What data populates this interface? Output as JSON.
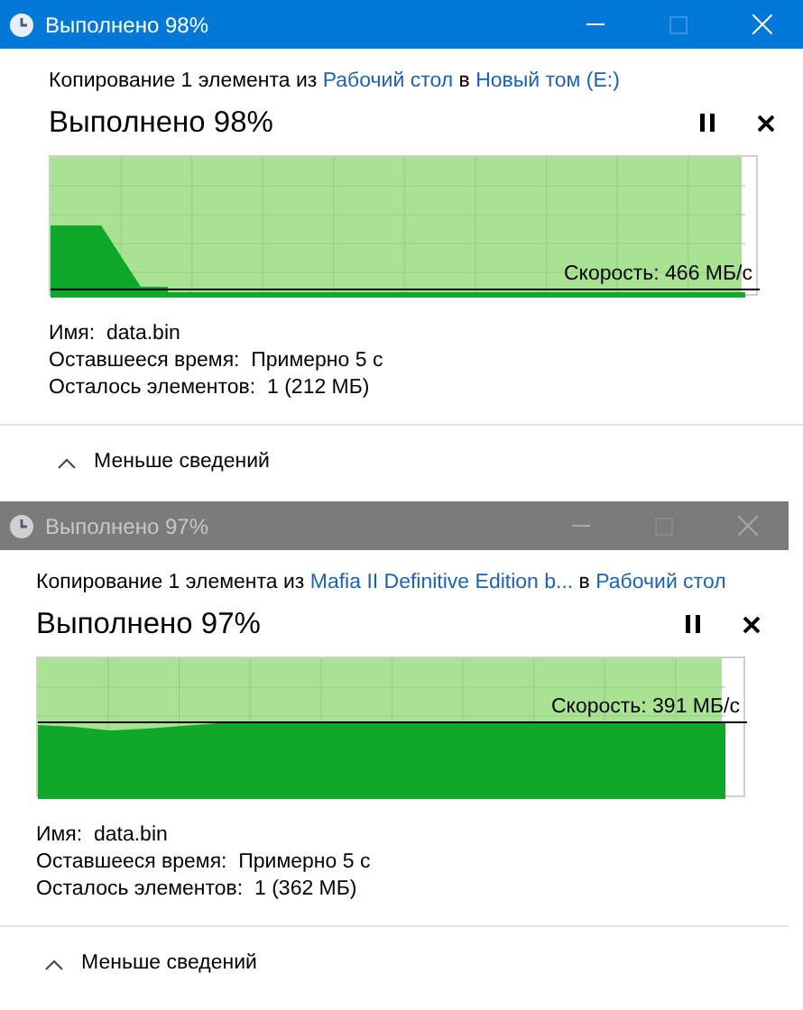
{
  "windows": [
    {
      "title": "Выполнено 98%",
      "active": true,
      "copy_line": {
        "prefix": "Копирование 1 элемента из",
        "source": "Рабочий стол",
        "middle": "в",
        "destination": "Новый том (E:)"
      },
      "heading": "Выполнено 98%",
      "progress": {
        "level": 0.98
      },
      "speed": "Скорость: 466 МБ/с",
      "details": [
        {
          "label": "Имя:",
          "value": "data.bin"
        },
        {
          "label": "Оставшееся время:",
          "value": "Примерно 5 с"
        },
        {
          "label": "Осталось элементов:",
          "value": "1 (212 МБ)"
        }
      ],
      "toggle": "Меньше сведений"
    },
    {
      "title": "Выполнено 97%",
      "active": false,
      "copy_line": {
        "prefix": "Копирование 1 элемента из",
        "source": "Mafia II Definitive Edition b...",
        "middle": "в",
        "destination": "Рабочий стол"
      },
      "heading": "Выполнено 97%",
      "progress": {
        "level": 0.97
      },
      "speed": "Скорость: 391 МБ/с",
      "details": [
        {
          "label": "Имя:",
          "value": "data.bin"
        },
        {
          "label": "Оставшееся время:",
          "value": "Примерно 5 с"
        },
        {
          "label": "Осталось элементов:",
          "value": "1 (362 МБ)"
        }
      ],
      "toggle": "Меньше сведений"
    }
  ]
}
